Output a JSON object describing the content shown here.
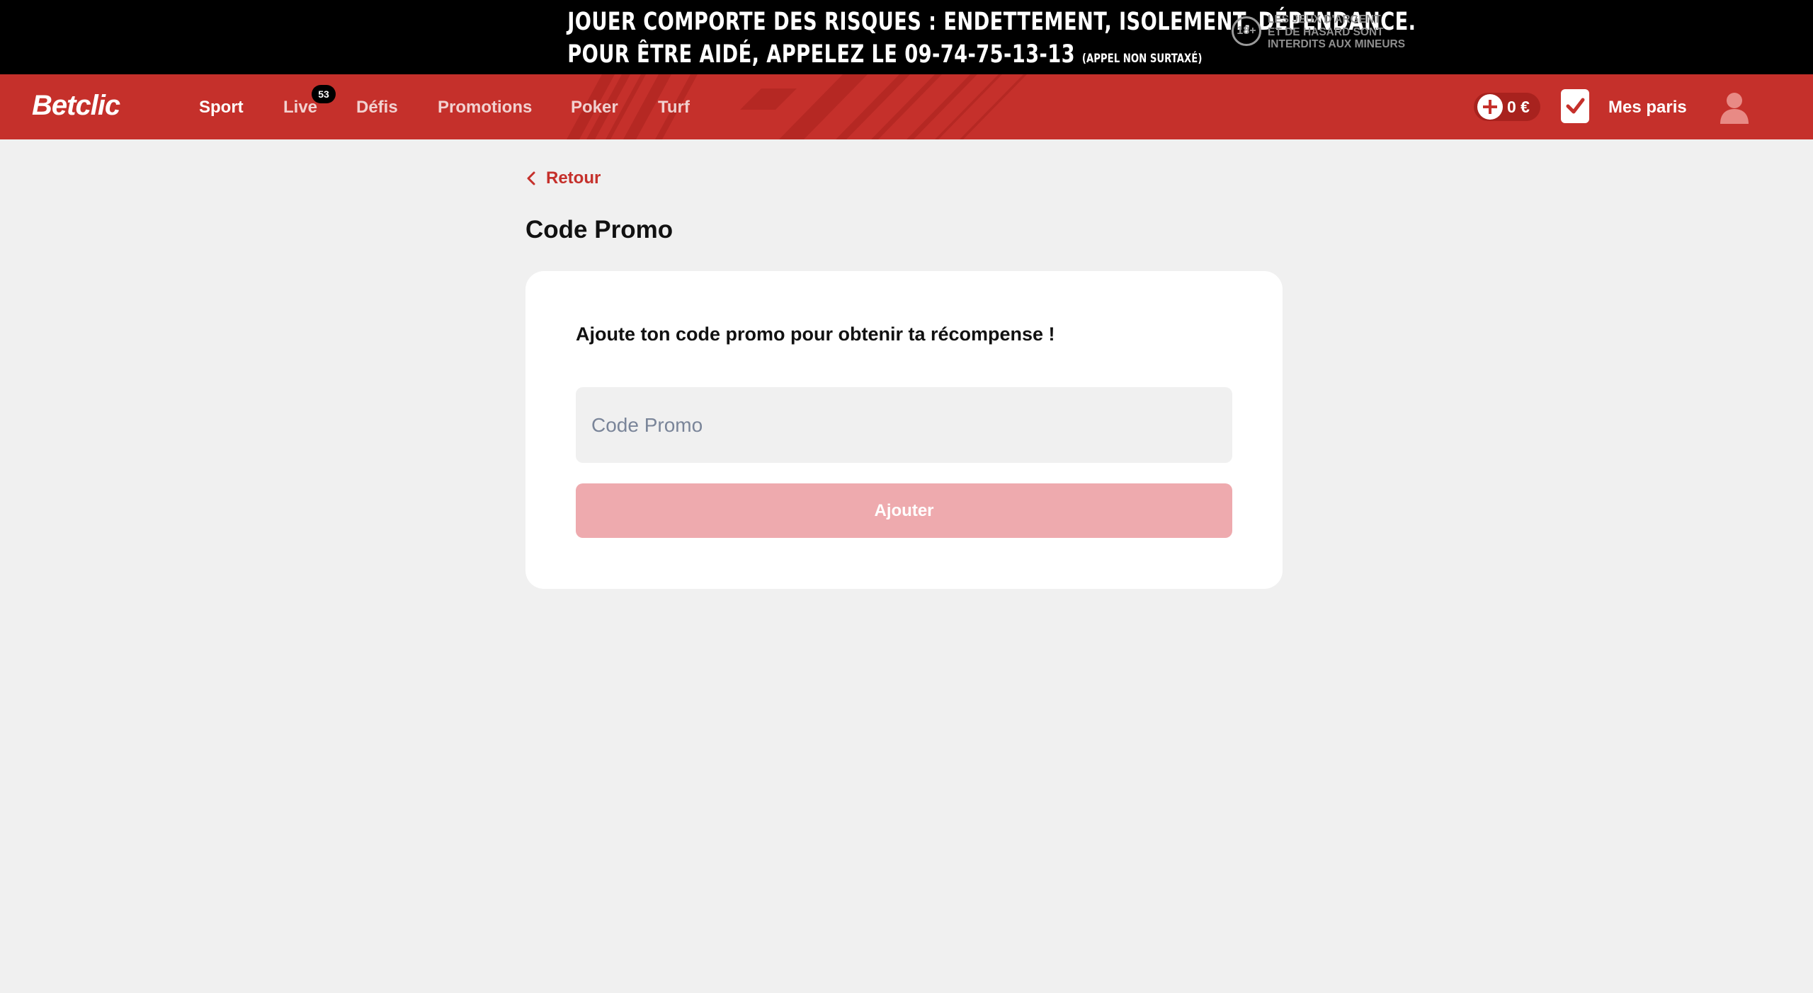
{
  "banner": {
    "line1": "JOUER COMPORTE DES RISQUES : ENDETTEMENT, ISOLEMENT, DÉPENDANCE.",
    "line2": "POUR ÊTRE AIDÉ, APPELEZ LE 09-74-75-13-13",
    "line2_small": "(APPEL NON SURTAXÉ)",
    "age_badge": "18+",
    "age_line1": "LES JEUX D'ARGENT",
    "age_line2": "ET DE HASARD SONT",
    "age_line3": "INTERDITS AUX MINEURS"
  },
  "header": {
    "logo": "Betclic",
    "nav": {
      "sport": "Sport",
      "live": "Live",
      "live_count": "53",
      "defis": "Défis",
      "promotions": "Promotions",
      "poker": "Poker",
      "turf": "Turf"
    },
    "balance": "0 €",
    "mes_paris": "Mes paris",
    "icons": {
      "deposit": "plus-circle-icon",
      "bets": "checkbox-icon",
      "account": "user-icon"
    }
  },
  "main": {
    "back_label": "Retour",
    "title": "Code Promo",
    "card": {
      "heading": "Ajoute ton code promo pour obtenir ta récompense !",
      "input_placeholder": "Code Promo",
      "input_value": "",
      "submit_label": "Ajouter"
    }
  },
  "colors": {
    "brand_red": "#c5302b",
    "button_disabled": "#eeaaae",
    "background": "#f0f0f0"
  }
}
